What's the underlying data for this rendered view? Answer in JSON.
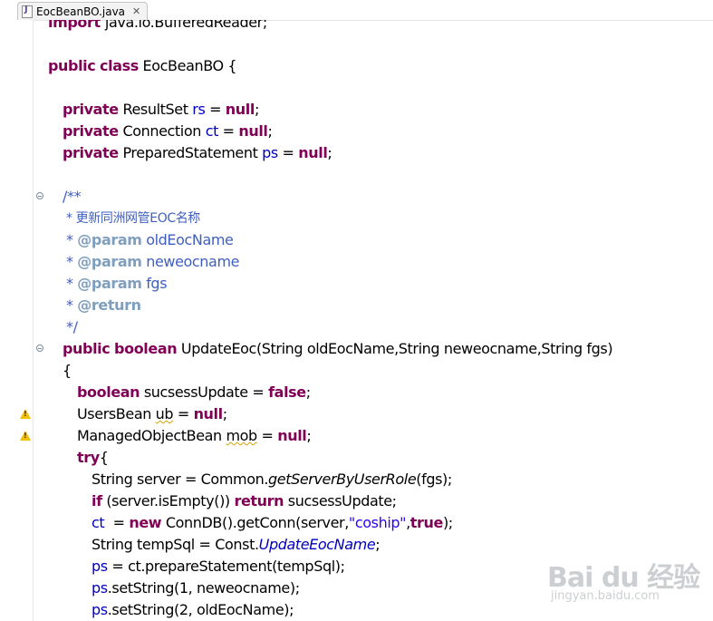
{
  "editor_tab": {
    "filename": "EocBeanBO.java",
    "close_glyph": "✕"
  },
  "code": {
    "import_prefix": "import ",
    "import_rest": "java.io.BufferedReader;",
    "kw_public": "public",
    "kw_class": "class",
    "class_decl_rest": " EocBeanBO {",
    "kw_private": "private",
    "kw_null": "null",
    "kw_boolean": "boolean",
    "kw_false": "false",
    "kw_try": "try",
    "kw_if": "if",
    "kw_return": "return",
    "kw_new": "new",
    "kw_true": "true",
    "type_resultset": "ResultSet",
    "type_connection": "Connection",
    "type_prepared": "PreparedStatement",
    "fld_rs": "rs",
    "fld_ct": "ct",
    "fld_ps": "ps",
    "assign_null": " = ",
    "semicolon": ";",
    "doc_open": "/**",
    "doc_desc": "* 更新同洲网管EOC名称",
    "doc_star": "* ",
    "tag_param": "@param",
    "tag_return": "@return",
    "param_old": " oldEocName",
    "param_new": " neweocname",
    "param_fgs": " fgs",
    "doc_close": "*/",
    "method_sig": " UpdateEoc(String oldEocName,String neweocname,String fgs)",
    "open_brace": "{",
    "var_sucsess": " sucsessUpdate = ",
    "users_bean": "UsersBean ",
    "var_ub": "ub",
    "managed_bean": "ManagedObjectBean ",
    "var_mob": "mob",
    "eq": " = ",
    "try_brace": "{",
    "server_decl": "String server = Common.",
    "server_method": "getServerByUserRole",
    "server_args": "(fgs);",
    "if_cond": " (server.isEmpty()) ",
    "if_tail": " sucsessUpdate;",
    "ct_assign": "  = ",
    "conn_call": " ConnDB().getConn(server,",
    "str_coship": "\"coship\"",
    "comma": ",",
    "conn_end": ");",
    "tempsql_decl": "String tempSql = Const.",
    "const_update": "UpdateEocName",
    "ps_prepare": " = ct.prepareStatement(tempSql);",
    "ps_set1": ".setString(1, neweocname);",
    "ps_set2": ".setString(2, oldEocName);"
  },
  "watermark": {
    "brand": "Bai du 经验",
    "site": "jingyan.baidu.com"
  },
  "colors": {
    "keyword": "#7f0055",
    "field": "#0000c0",
    "javadoc": "#3f5fbf",
    "javadoc_tag": "#7f9fbf",
    "string": "#2a00ff",
    "warning": "#f0c000"
  }
}
